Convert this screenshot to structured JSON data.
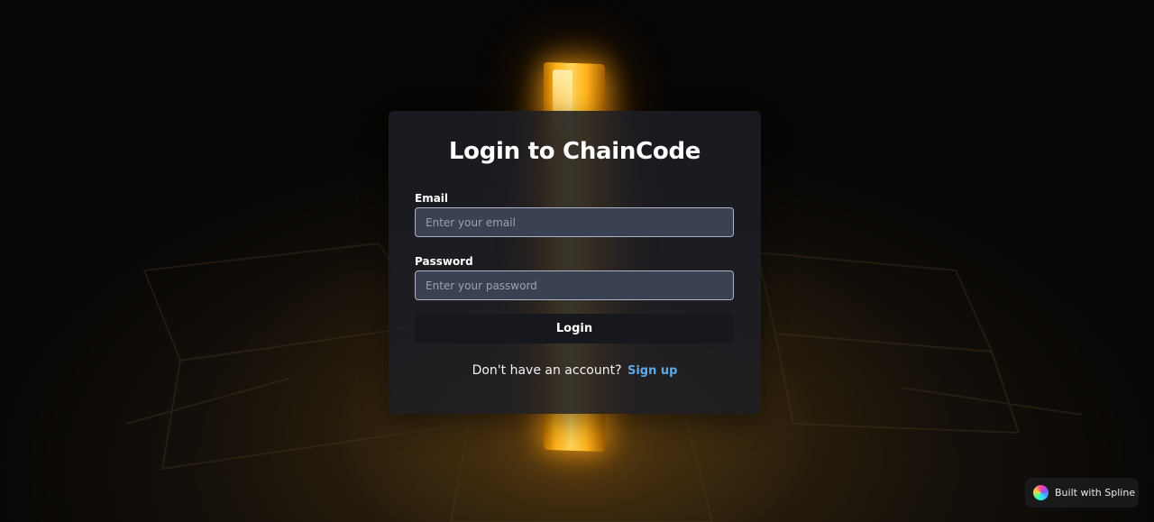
{
  "login_card": {
    "title": "Login to ChainCode",
    "email_label": "Email",
    "email_placeholder": "Enter your email",
    "email_value": "",
    "password_label": "Password",
    "password_placeholder": "Enter your password",
    "password_value": "",
    "login_button": "Login",
    "signup_prompt": "Don't have an account?",
    "signup_link": "Sign up"
  },
  "badge": {
    "text": "Built with Spline",
    "icon": "spline-logo-icon"
  },
  "colors": {
    "accent_link": "#5fa8ea",
    "beam_glow": "#ffb21a",
    "card_bg": "#1c1e24",
    "input_bg": "#3a4152",
    "button_bg": "#17181d"
  }
}
